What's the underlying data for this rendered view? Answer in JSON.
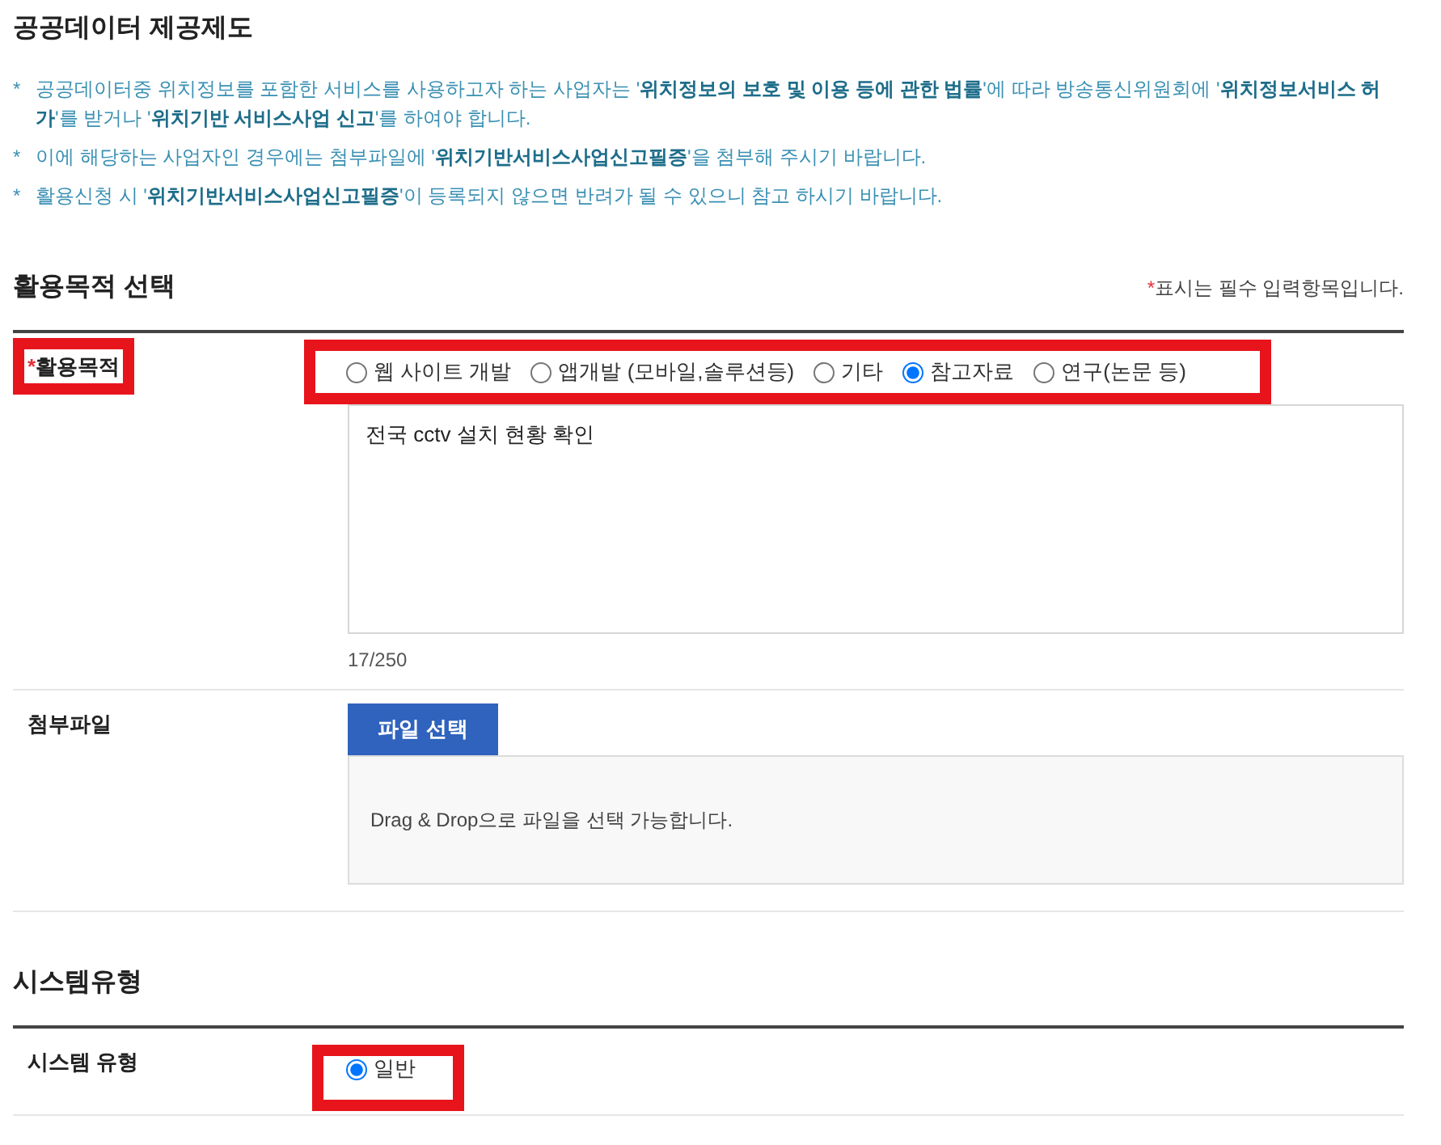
{
  "notice": {
    "title": "공공데이터 제공제도",
    "items": [
      {
        "bullet": "*",
        "text": "공공데이터중 위치정보를 포함한 서비스를 사용하고자 하는 사업자는 '**위치정보의 보호 및 이용 등에 관한 법률**'에 따라 방송통신위원회에 '**위치정보서비스 허가**'를 받거나 '**위치기반 서비스사업 신고**'를 하여야 합니다."
      },
      {
        "bullet": "*",
        "text": "이에 해당하는 사업자인 경우에는 첨부파일에 '**위치기반서비스사업신고필증**'을 첨부해 주시기 바랍니다."
      },
      {
        "bullet": "*",
        "text": "활용신청 시 '**위치기반서비스사업신고필증**'이 등록되지 않으면 반려가 될 수 있으니 참고 하시기 바랍니다."
      }
    ]
  },
  "sections": [
    {
      "title": "활용목적 선택",
      "required_note": {
        "mark": "*",
        "text": "표시는 필수 입력항목입니다."
      },
      "rows": [
        {
          "kind": "purpose",
          "required_mark": "*",
          "label": "활용목적",
          "label_highlighted": true,
          "options_highlighted": true,
          "options": [
            {
              "label": "웹 사이트 개발",
              "selected": false
            },
            {
              "label": "앱개발 (모바일,솔루션등)",
              "selected": false
            },
            {
              "label": "기타",
              "selected": false
            },
            {
              "label": "참고자료",
              "selected": true
            },
            {
              "label": "연구(논문 등)",
              "selected": false
            }
          ],
          "value": "전국 cctv 설치 현황 확인",
          "counter": "17/250"
        },
        {
          "kind": "file",
          "label": "첨부파일",
          "label_highlighted": false,
          "button": "파일 선택",
          "drop_hint": "Drag & Drop으로 파일을 선택 가능합니다."
        }
      ]
    },
    {
      "title": "시스템유형",
      "rows": [
        {
          "kind": "system",
          "label": "시스템 유형",
          "label_highlighted": false,
          "options_highlighted": true,
          "options": [
            {
              "label": "일반",
              "selected": true
            }
          ]
        }
      ]
    }
  ]
}
